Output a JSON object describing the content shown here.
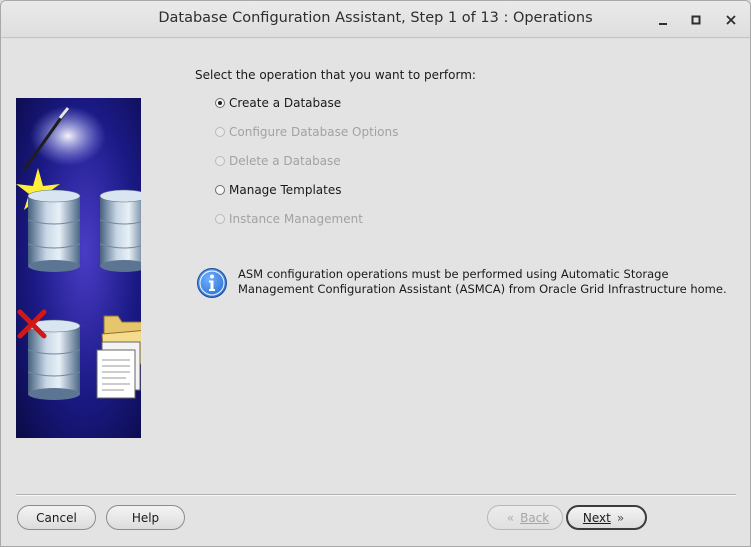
{
  "window": {
    "title": "Database Configuration Assistant, Step 1 of 13 : Operations"
  },
  "main": {
    "prompt": "Select the operation that you want to perform:",
    "options": [
      {
        "label": "Create a Database",
        "checked": true,
        "enabled": true
      },
      {
        "label": "Configure Database Options",
        "checked": false,
        "enabled": false
      },
      {
        "label": "Delete a Database",
        "checked": false,
        "enabled": false
      },
      {
        "label": "Manage Templates",
        "checked": false,
        "enabled": true
      },
      {
        "label": "Instance Management",
        "checked": false,
        "enabled": false
      }
    ],
    "info": {
      "icon": "info-icon",
      "line1": "ASM configuration operations must be performed using Automatic Storage",
      "line2": "Management Configuration Assistant (ASMCA) from Oracle Grid Infrastructure home."
    }
  },
  "buttons": {
    "cancel": "Cancel",
    "help": "Help",
    "back": "Back",
    "next": "Next"
  },
  "colors": {
    "panel_background": "#10105a",
    "info_blue": "#2a6fd0",
    "check_red": "#d01818"
  }
}
